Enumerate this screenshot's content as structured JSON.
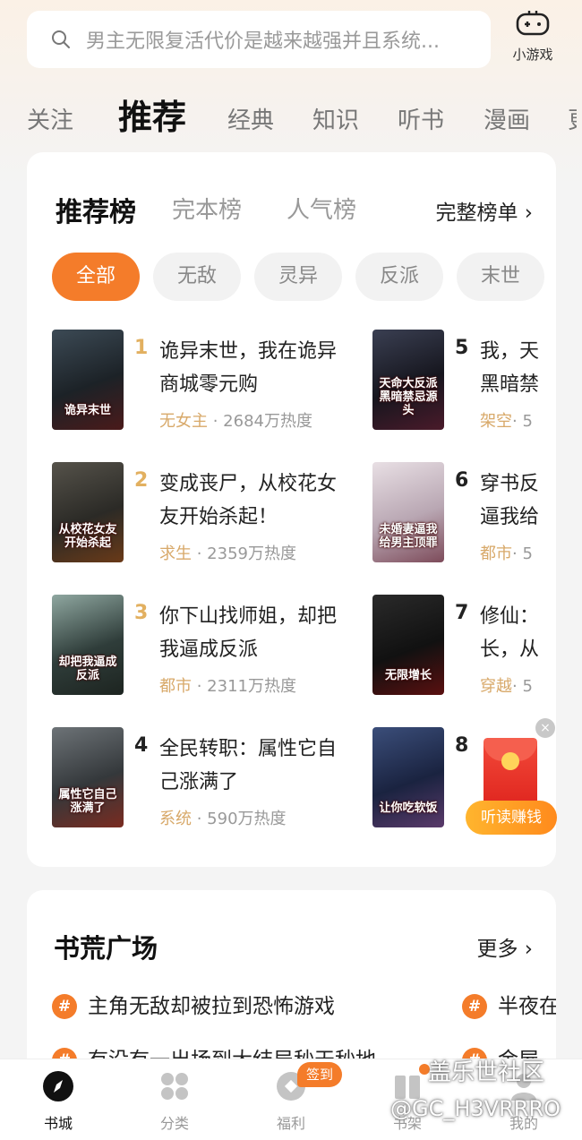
{
  "search": {
    "placeholder": "男主无限复活代价是越来越强并且系统..."
  },
  "minigame": {
    "label": "小游戏",
    "icon": "gamepad-icon"
  },
  "tabs": [
    "关注",
    "推荐",
    "经典",
    "知识",
    "听书",
    "漫画"
  ],
  "active_tab": "推荐",
  "rank": {
    "tabs": [
      "推荐榜",
      "完本榜",
      "人气榜"
    ],
    "full_list": "完整榜单 ›",
    "chips": [
      "全部",
      "无敌",
      "灵异",
      "反派",
      "末世"
    ],
    "left_books": [
      {
        "no": "1",
        "title": "诡异末世，我在诡异商城零元购",
        "tag": "无女主",
        "heat": "2684万热度",
        "cover_text": "诡异末世"
      },
      {
        "no": "2",
        "title": "变成丧尸，从校花女友开始杀起！",
        "tag": "求生",
        "heat": "2359万热度",
        "cover_text": "从校花女友开始杀起"
      },
      {
        "no": "3",
        "title": "你下山找师姐，却把我逼成反派",
        "tag": "都市",
        "heat": "2311万热度",
        "cover_text": "却把我逼成反派"
      },
      {
        "no": "4",
        "title": "全民转职：属性它自己涨满了",
        "tag": "系统",
        "heat": "590万热度",
        "cover_text": "属性它自己涨满了"
      }
    ],
    "right_books": [
      {
        "no": "5",
        "title": "我，天黑暗禁",
        "tag": "架空",
        "heat": "· 5",
        "cover_text": "天命大反派黑暗禁忌源头"
      },
      {
        "no": "6",
        "title": "穿书反逼我给",
        "tag": "都市",
        "heat": "· 5",
        "cover_text": "未婚妻逼我给男主顶罪"
      },
      {
        "no": "7",
        "title": "修仙：长，从",
        "tag": "穿越",
        "heat": "· 5",
        "cover_text": "无限增长"
      },
      {
        "no": "8",
        "title": "",
        "tag": "",
        "heat": "",
        "cover_text": "让你吃软饭"
      }
    ],
    "sep": " · "
  },
  "redpacket": {
    "label": "听读赚钱",
    "close": "×"
  },
  "plaza": {
    "title": "书荒广场",
    "more": "更多 ›",
    "topics": [
      "主角无敌却被拉到恐怖游戏",
      "有没有一出场到大结局秒天秒地",
      "半夜在",
      "金屋"
    ],
    "hash": "#"
  },
  "nav": {
    "items": [
      "书城",
      "分类",
      "福利",
      "书架",
      "我的"
    ],
    "active": "书城",
    "checkin": "签到"
  },
  "watermark": {
    "line1": "盖乐世社区",
    "line2": "@GC_H3VRRRO"
  },
  "colors": {
    "accent": "#f47c2a",
    "tag": "#d8a96a",
    "rank_top": "#e2b060"
  }
}
